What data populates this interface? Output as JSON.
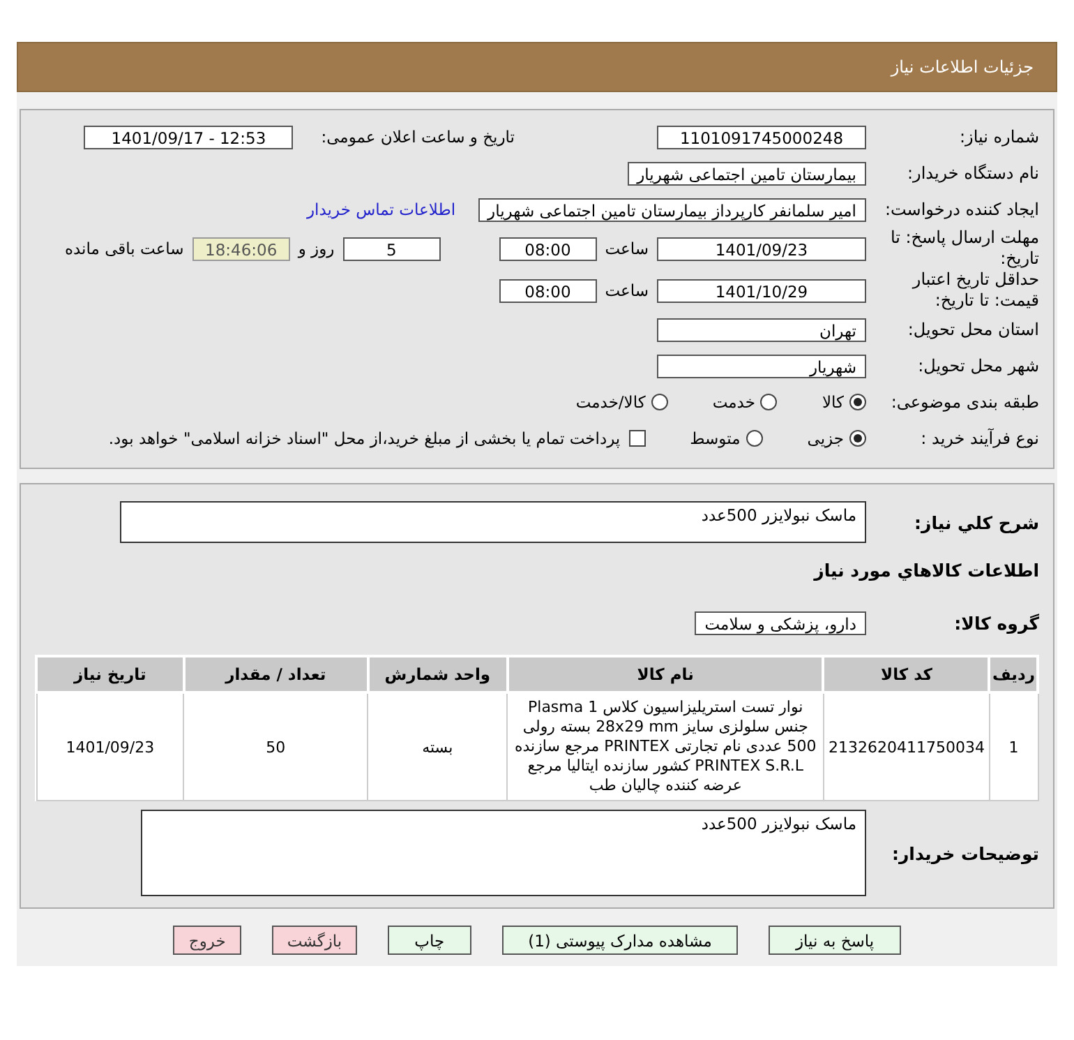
{
  "header": {
    "title": "جزئیات اطلاعات نیاز"
  },
  "need_number": {
    "label": "شماره نیاز:",
    "value": "1101091745000248"
  },
  "announce": {
    "label": "تاریخ و ساعت اعلان عمومی:",
    "value": "1401/09/17 - 12:53"
  },
  "buyer_org": {
    "label": "نام دستگاه خریدار:",
    "value": "بیمارستان تامین اجتماعی شهریار"
  },
  "requester": {
    "label": "ایجاد کننده درخواست:",
    "value": "امیر سلمانفر کارپرداز بیمارستان تامین اجتماعی شهریار",
    "link": "اطلاعات تماس خریدار"
  },
  "deadline": {
    "label": "مهلت ارسال پاسخ: تا تاریخ:",
    "date": "1401/09/23",
    "time_label": "ساعت",
    "time": "08:00",
    "days": "5",
    "days_label": "روز و",
    "remaining": "18:46:06",
    "remaining_label": "ساعت باقی مانده"
  },
  "validity": {
    "label": "حداقل تاریخ اعتبار قیمت: تا تاریخ:",
    "date": "1401/10/29",
    "time_label": "ساعت",
    "time": "08:00"
  },
  "province": {
    "label": "استان محل تحویل:",
    "value": "تهران"
  },
  "city": {
    "label": "شهر محل تحویل:",
    "value": "شهریار"
  },
  "category": {
    "label": "طبقه بندی موضوعی:",
    "options": [
      {
        "label": "کالا",
        "selected": true
      },
      {
        "label": "خدمت",
        "selected": false
      },
      {
        "label": "کالا/خدمت",
        "selected": false
      }
    ]
  },
  "process": {
    "label": "نوع فرآیند خرید :",
    "options": [
      {
        "label": "جزیی",
        "selected": true
      },
      {
        "label": "متوسط",
        "selected": false
      }
    ],
    "payment": {
      "label": "پرداخت تمام یا بخشی از مبلغ خرید،از محل \"اسناد خزانه اسلامی\" خواهد بود.",
      "checked": false
    }
  },
  "summary": {
    "label": "شرح کلي نياز:",
    "value": "ماسک نبولایزر 500عدد"
  },
  "goods_title": "اطلاعات کالاهاي مورد نياز",
  "goods_group": {
    "label": "گروه کالا:",
    "value": "دارو، پزشکی و سلامت"
  },
  "table": {
    "columns": [
      "ردیف",
      "کد کالا",
      "نام کالا",
      "واحد شمارش",
      "تعداد / مقدار",
      "تاریخ نیاز"
    ],
    "rows": [
      {
        "cells": [
          "1",
          "2132620411750034",
          "نوار تست استریلیزاسیون کلاس Plasma 1 جنس سلولزی سایز 28x29 mm بسته رولی 500 عددی نام تجارتی PRINTEX مرجع سازنده PRINTEX S.R.L کشور سازنده ایتالیا مرجع عرضه کننده چالیان طب",
          "بسته",
          "50",
          "1401/09/23"
        ]
      }
    ]
  },
  "buyer_notes": {
    "label": "توضیحات خریدار:",
    "value": "ماسک نبولایزر 500عدد"
  },
  "buttons": [
    {
      "label": "پاسخ به نیاز",
      "kind": "normal"
    },
    {
      "label": "مشاهده مدارک پیوستی (1)",
      "kind": "normal"
    },
    {
      "label": "چاپ",
      "kind": "normal"
    },
    {
      "label": "بازگشت",
      "kind": "danger"
    },
    {
      "label": "خروج",
      "kind": "danger"
    }
  ]
}
